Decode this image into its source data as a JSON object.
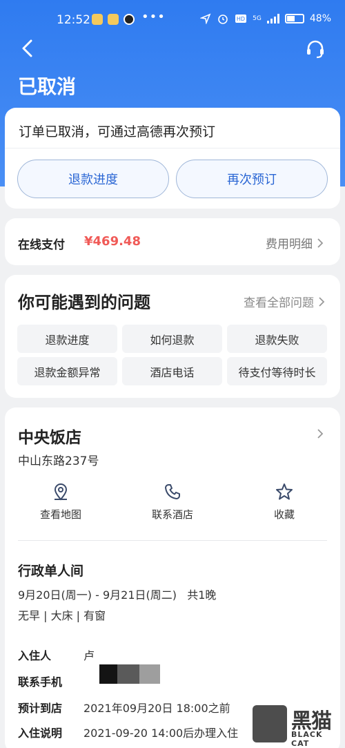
{
  "status_bar": {
    "time": "12:52",
    "dots": "•••",
    "network": "5G",
    "battery": "48"
  },
  "header": {
    "title": "已取消",
    "back_icon": "chevron-left-icon",
    "support_icon": "headset-icon",
    "color": "#2f7bf0"
  },
  "status_card": {
    "message": "订单已取消，可通过高德再次预订",
    "buttons": [
      {
        "label": "退款进度"
      },
      {
        "label": "再次预订"
      }
    ]
  },
  "payment": {
    "label": "在线支付",
    "amount": "¥469.48",
    "amount_color": "#f05a57",
    "detail_link": "费用明细"
  },
  "faq": {
    "title": "你可能遇到的问题",
    "view_all": "查看全部问题",
    "chips": [
      "退款进度",
      "如何退款",
      "退款失败",
      "退款金额异常",
      "酒店电话",
      "待支付等待时长"
    ]
  },
  "hotel": {
    "name": "中央饭店",
    "address": "中山东路237号",
    "actions": [
      {
        "label": "查看地图",
        "icon": "map-pin-icon"
      },
      {
        "label": "联系酒店",
        "icon": "phone-icon"
      },
      {
        "label": "收藏",
        "icon": "star-icon"
      }
    ],
    "room": {
      "name": "行政单人间",
      "dates": "9月20日(周一) - 9月21日(周二)   共1晚",
      "features": "无早 | 大床 | 有窗"
    },
    "info": [
      {
        "key": "入住人",
        "value": "卢"
      },
      {
        "key": "联系手机",
        "value": ""
      },
      {
        "key": "预计到店",
        "value": "2021年09月20日 18:00之前"
      },
      {
        "key": "入住说明",
        "value": "2021-09-20 14:00后办理入住"
      }
    ]
  },
  "watermark": {
    "brand": "黑猫",
    "sub": "BLACK CAT"
  }
}
